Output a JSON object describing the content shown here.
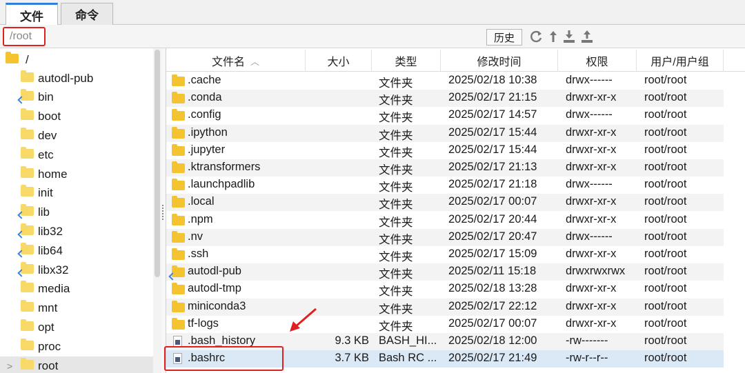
{
  "tabs": [
    {
      "label": "文件",
      "active": true
    },
    {
      "label": "命令",
      "active": false
    }
  ],
  "path": {
    "value": "/root"
  },
  "toolbar": {
    "history_label": "历史",
    "icons": [
      "refresh-icon",
      "up-icon",
      "download-icon",
      "upload-icon"
    ]
  },
  "tree": {
    "root_label": "/",
    "items": [
      "autodl-pub",
      "bin",
      "boot",
      "dev",
      "etc",
      "home",
      "init",
      "lib",
      "lib32",
      "lib64",
      "libx32",
      "media",
      "mnt",
      "opt",
      "proc",
      "root"
    ],
    "selected": "root"
  },
  "filelist": {
    "columns": [
      "文件名",
      "大小",
      "类型",
      "修改时间",
      "权限",
      "用户/用户组"
    ],
    "sort_indicator": "^",
    "rows": [
      {
        "name": ".cache",
        "size": "",
        "type": "文件夹",
        "mtime": "2025/02/18 10:38",
        "perm": "drwx------",
        "owner": "root/root",
        "icon": "folder"
      },
      {
        "name": ".conda",
        "size": "",
        "type": "文件夹",
        "mtime": "2025/02/17 21:15",
        "perm": "drwxr-xr-x",
        "owner": "root/root",
        "icon": "folder"
      },
      {
        "name": ".config",
        "size": "",
        "type": "文件夹",
        "mtime": "2025/02/17 14:57",
        "perm": "drwx------",
        "owner": "root/root",
        "icon": "folder"
      },
      {
        "name": ".ipython",
        "size": "",
        "type": "文件夹",
        "mtime": "2025/02/17 15:44",
        "perm": "drwxr-xr-x",
        "owner": "root/root",
        "icon": "folder"
      },
      {
        "name": ".jupyter",
        "size": "",
        "type": "文件夹",
        "mtime": "2025/02/17 15:44",
        "perm": "drwxr-xr-x",
        "owner": "root/root",
        "icon": "folder"
      },
      {
        "name": ".ktransformers",
        "size": "",
        "type": "文件夹",
        "mtime": "2025/02/17 21:13",
        "perm": "drwxr-xr-x",
        "owner": "root/root",
        "icon": "folder"
      },
      {
        "name": ".launchpadlib",
        "size": "",
        "type": "文件夹",
        "mtime": "2025/02/17 21:18",
        "perm": "drwx------",
        "owner": "root/root",
        "icon": "folder"
      },
      {
        "name": ".local",
        "size": "",
        "type": "文件夹",
        "mtime": "2025/02/17 00:07",
        "perm": "drwxr-xr-x",
        "owner": "root/root",
        "icon": "folder"
      },
      {
        "name": ".npm",
        "size": "",
        "type": "文件夹",
        "mtime": "2025/02/17 20:44",
        "perm": "drwxr-xr-x",
        "owner": "root/root",
        "icon": "folder"
      },
      {
        "name": ".nv",
        "size": "",
        "type": "文件夹",
        "mtime": "2025/02/17 20:47",
        "perm": "drwx------",
        "owner": "root/root",
        "icon": "folder"
      },
      {
        "name": ".ssh",
        "size": "",
        "type": "文件夹",
        "mtime": "2025/02/17 15:09",
        "perm": "drwxr-xr-x",
        "owner": "root/root",
        "icon": "folder"
      },
      {
        "name": "autodl-pub",
        "size": "",
        "type": "文件夹",
        "mtime": "2025/02/11 15:18",
        "perm": "drwxrwxrwx",
        "owner": "root/root",
        "icon": "folder-link"
      },
      {
        "name": "autodl-tmp",
        "size": "",
        "type": "文件夹",
        "mtime": "2025/02/18 13:28",
        "perm": "drwxr-xr-x",
        "owner": "root/root",
        "icon": "folder"
      },
      {
        "name": "miniconda3",
        "size": "",
        "type": "文件夹",
        "mtime": "2025/02/17 22:12",
        "perm": "drwxr-xr-x",
        "owner": "root/root",
        "icon": "folder"
      },
      {
        "name": "tf-logs",
        "size": "",
        "type": "文件夹",
        "mtime": "2025/02/17 00:07",
        "perm": "drwxr-xr-x",
        "owner": "root/root",
        "icon": "folder"
      },
      {
        "name": ".bash_history",
        "size": "9.3 KB",
        "type": "BASH_HI...",
        "mtime": "2025/02/18 12:00",
        "perm": "-rw-------",
        "owner": "root/root",
        "icon": "file"
      },
      {
        "name": ".bashrc",
        "size": "3.7 KB",
        "type": "Bash RC ...",
        "mtime": "2025/02/17 21:49",
        "perm": "-rw-r--r--",
        "owner": "root/root",
        "icon": "file",
        "selected": true
      }
    ]
  },
  "colors": {
    "highlight": "#e02020",
    "accent": "#2f7fd8",
    "folder": "#f4c430",
    "selection": "#dbe8f5"
  }
}
